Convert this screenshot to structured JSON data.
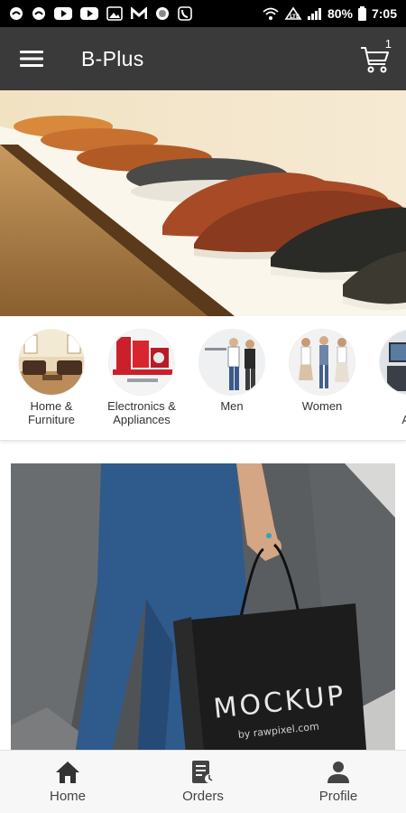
{
  "status_bar": {
    "battery": "80%",
    "time": "7:05",
    "icons": [
      "app-icon",
      "app-icon",
      "youtube-icon",
      "youtube-icon",
      "gallery-icon",
      "gmail-icon",
      "circle-app-icon",
      "call-icon",
      "wifi-icon",
      "data-saver-icon",
      "signal-icon",
      "battery-icon"
    ]
  },
  "app_bar": {
    "title": "B-Plus",
    "cart_count": "1",
    "background": "#3a3a3a"
  },
  "categories": [
    {
      "label": "Home &\nFurniture"
    },
    {
      "label": "Electronics &\nAppliances"
    },
    {
      "label": "Men"
    },
    {
      "label": "Women"
    },
    {
      "label": "T\nApp"
    }
  ],
  "promo": {
    "bag_text": "MOCKUP",
    "bag_subtext": "by rawpixel.com"
  },
  "bottom_nav": {
    "items": [
      {
        "label": "Home",
        "icon": "home-icon"
      },
      {
        "label": "Orders",
        "icon": "orders-icon"
      },
      {
        "label": "Profile",
        "icon": "profile-icon"
      }
    ]
  }
}
